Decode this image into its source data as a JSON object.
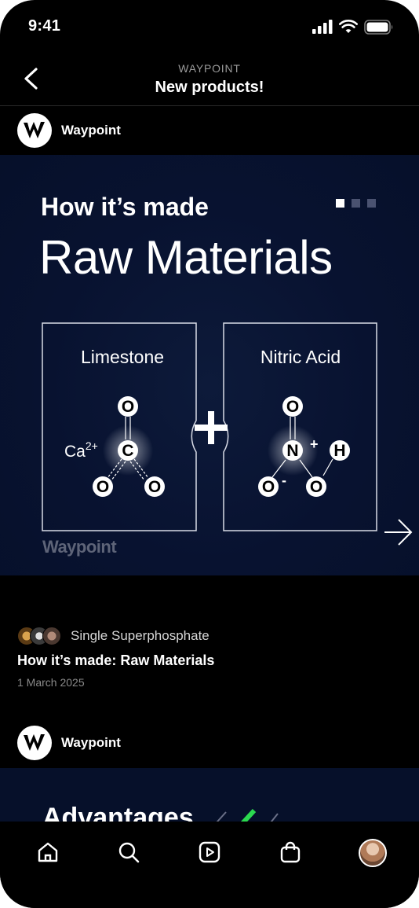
{
  "status_bar": {
    "time": "9:41"
  },
  "header": {
    "subtitle": "WAYPOINT",
    "title": "New products!"
  },
  "feed": {
    "post1": {
      "author": "Waypoint",
      "slide": {
        "kicker": "How it’s made",
        "title": "Raw Materials",
        "left_box_label": "Limestone",
        "right_box_label": "Nitric Acid",
        "ion_label": "Ca2+",
        "watermark": "Waypoint",
        "page_count": 3,
        "active_page": 1
      },
      "tag": "Single Superphosphate",
      "title": "How it’s made: Raw Materials",
      "date": "1 March 2025"
    },
    "post2": {
      "author": "Waypoint",
      "slide_title": "Advantages"
    }
  },
  "tab_bar": {
    "items": [
      "home-icon",
      "search-icon",
      "video-icon",
      "shopping-bag-icon",
      "profile-avatar"
    ]
  },
  "colors": {
    "background": "#000000",
    "card": "#081230",
    "accent_check": "#2bd94f"
  }
}
